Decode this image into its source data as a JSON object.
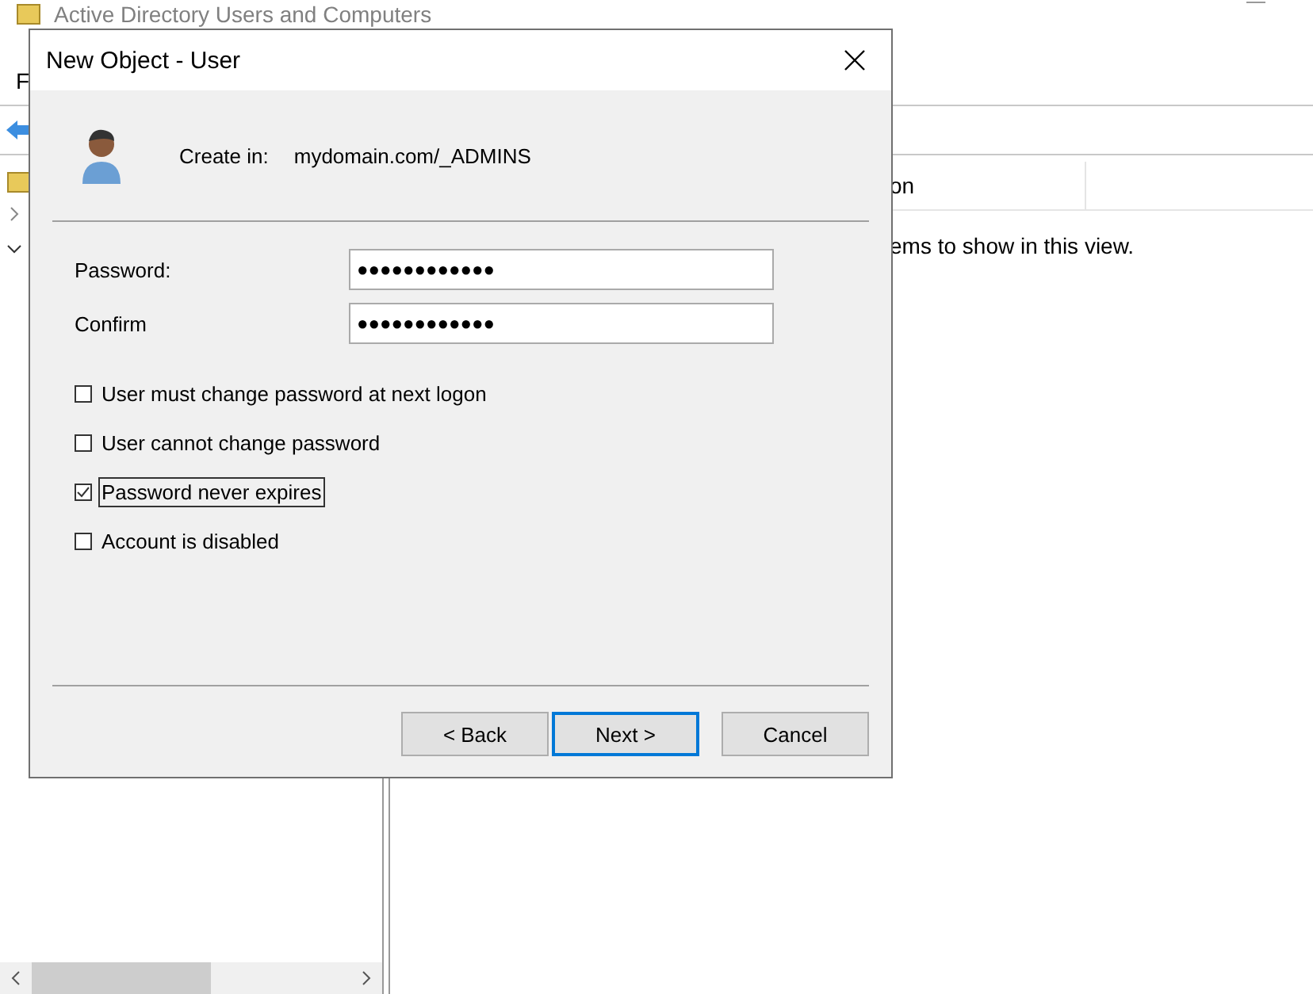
{
  "app_window": {
    "title": "Active Directory Users and Computers",
    "menu": [
      "F"
    ],
    "list_header": [
      "on"
    ],
    "list_message": "ems to show in this view."
  },
  "dialog": {
    "title": "New Object - User",
    "create_in_label": "Create in:",
    "create_in_value": "mydomain.com/_ADMINS",
    "fields": [
      {
        "label": "Password:",
        "value": "●●●●●●●●●●●●"
      },
      {
        "label": "Confirm",
        "value": "●●●●●●●●●●●●"
      }
    ],
    "options": [
      {
        "label": "User must change password at next logon",
        "checked": false,
        "focused": false
      },
      {
        "label": "User cannot change password",
        "checked": false,
        "focused": false
      },
      {
        "label": "Password never expires",
        "checked": true,
        "focused": true
      },
      {
        "label": "Account is disabled",
        "checked": false,
        "focused": false
      }
    ],
    "buttons": [
      {
        "label": "< Back",
        "default": false
      },
      {
        "label": "Next >",
        "default": true
      },
      {
        "label": "Cancel",
        "default": false
      }
    ]
  }
}
